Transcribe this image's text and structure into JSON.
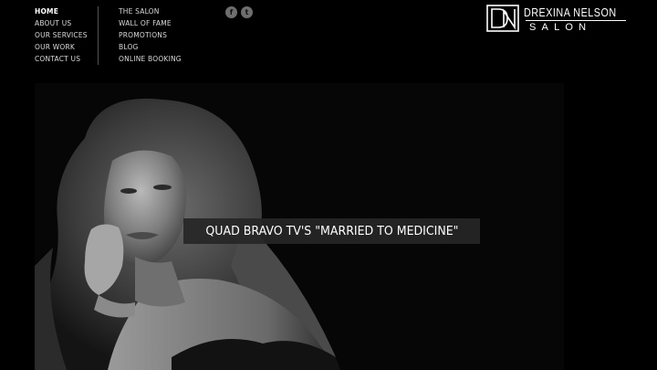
{
  "nav": {
    "left": [
      "HOME",
      "ABOUT US",
      "OUR SERVICES",
      "OUR WORK",
      "CONTACT US"
    ],
    "right": [
      "THE SALON",
      "WALL OF FAME",
      "PROMOTIONS",
      "BLOG",
      "ONLINE BOOKING"
    ],
    "active": "HOME"
  },
  "social": {
    "facebook_glyph": "f",
    "twitter_glyph": "t",
    "icons": [
      "facebook-icon",
      "twitter-icon"
    ]
  },
  "logo": {
    "name": "DREXINA NELSON",
    "sub": "SALON"
  },
  "hero": {
    "caption": "QUAD BRAVO TV'S \"MARRIED TO MEDICINE\""
  },
  "colors": {
    "background": "#000000",
    "nav_text": "#d9d9d9",
    "caption_bg": "#262626",
    "social_icon": "#6e6e6e"
  }
}
